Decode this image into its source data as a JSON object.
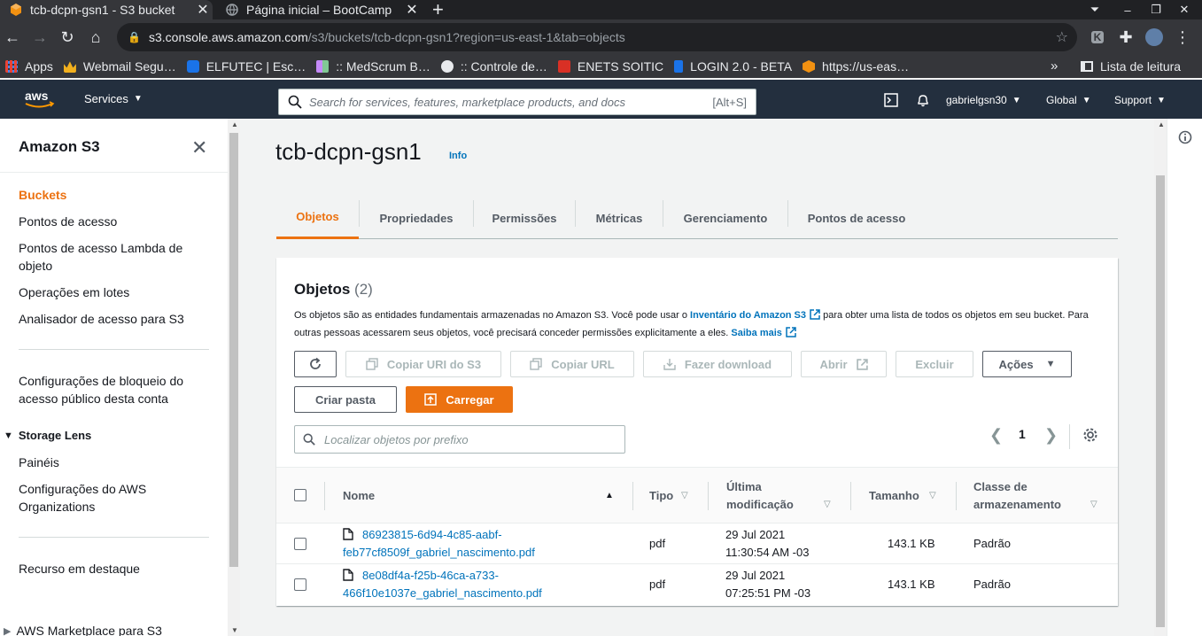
{
  "browser": {
    "tabs": [
      {
        "title": "tcb-dcpn-gsn1 - S3 bucket"
      },
      {
        "title": "Página inicial – BootCamp"
      }
    ],
    "url": {
      "host": "s3.console.aws.amazon.com",
      "path": "/s3/buckets/tcb-dcpn-gsn1?region=us-east-1&tab=objects"
    },
    "bookmarks": [
      {
        "label": "Apps",
        "icon": "apps-grid-icon",
        "color": "#ea4335"
      },
      {
        "label": "Webmail Segu…",
        "icon": "crown-icon",
        "color": "#f2b01e"
      },
      {
        "label": "ELFUTEC | Esc…",
        "icon": "elfutec-icon",
        "color": "#1a73e8"
      },
      {
        "label": ":: MedScrum B…",
        "icon": "medscrum-icon",
        "color": "#c58af9"
      },
      {
        "label": ":: Controle de…",
        "icon": "globe-icon",
        "color": "#e8eaed"
      },
      {
        "label": "ENETS SOITIC",
        "icon": "enets-icon",
        "color": "#d93025"
      },
      {
        "label": "LOGIN 2.0 - BETA",
        "icon": "login-icon",
        "color": "#1a73e8"
      },
      {
        "label": "https://us-eas…",
        "icon": "aws-cube-icon",
        "color": "#f29111"
      }
    ],
    "more": "»",
    "reading_list": "Lista de leitura"
  },
  "aws_nav": {
    "services": "Services",
    "search_placeholder": "Search for services, features, marketplace products, and docs",
    "shortcut": "[Alt+S]",
    "user": "gabrielgsn30",
    "region": "Global",
    "support": "Support"
  },
  "sidebar": {
    "title": "Amazon S3",
    "items": [
      {
        "label": "Buckets",
        "active": true
      },
      {
        "label": "Pontos de acesso"
      },
      {
        "label": "Pontos de acesso Lambda de objeto"
      },
      {
        "label": "Operações em lotes"
      },
      {
        "label": "Analisador de acesso para S3"
      }
    ],
    "block_settings": "Configurações de bloqueio do acesso público desta conta",
    "storage_lens": {
      "label": "Storage Lens",
      "items": [
        "Painéis",
        "Configurações do AWS Organizations"
      ]
    },
    "featured": "Recurso em destaque",
    "marketplace": "AWS Marketplace para S3"
  },
  "main": {
    "bucket_name": "tcb-dcpn-gsn1",
    "info": "Info",
    "tabs": [
      "Objetos",
      "Propriedades",
      "Permissões",
      "Métricas",
      "Gerenciamento",
      "Pontos de acesso"
    ],
    "active_tab": "Objetos",
    "objects": {
      "title": "Objetos",
      "count": "(2)",
      "desc_part1": "Os objetos são as entidades fundamentais armazenadas no Amazon S3. Você pode usar o ",
      "desc_link1": "Inventário do Amazon S3",
      "desc_part2": " para obter uma lista de todos os objetos em seu bucket. Para outras pessoas acessarem seus objetos, você precisará conceder permissões explicitamente a eles. ",
      "desc_link2": "Saiba mais",
      "buttons": {
        "copy_uri": "Copiar URI do S3",
        "copy_url": "Copiar URL",
        "download": "Fazer download",
        "open": "Abrir",
        "delete": "Excluir",
        "actions": "Ações",
        "create_folder": "Criar pasta",
        "upload": "Carregar"
      },
      "filter_placeholder": "Localizar objetos por prefixo",
      "page": "1",
      "columns": {
        "name": "Nome",
        "type": "Tipo",
        "modified_l1": "Última",
        "modified_l2": "modificação",
        "size": "Tamanho",
        "class_l1": "Classe de",
        "class_l2": "armazenamento"
      },
      "rows": [
        {
          "name_l1": "86923815-6d94-4c85-aabf-",
          "name_l2": "feb77cf8509f_gabriel_nascimento.pdf",
          "type": "pdf",
          "date": "29 Jul 2021",
          "time": "11:30:54 AM -03",
          "size": "143.1 KB",
          "class": "Padrão"
        },
        {
          "name_l1": "8e08df4a-f25b-46ca-a733-",
          "name_l2": "466f10e1037e_gabriel_nascimento.pdf",
          "type": "pdf",
          "date": "29 Jul 2021",
          "time": "07:25:51 PM -03",
          "size": "143.1 KB",
          "class": "Padrão"
        }
      ]
    }
  },
  "colors": {
    "accent": "#ec7211",
    "link": "#0073bb",
    "aws_nav_bg": "#232f3e"
  }
}
